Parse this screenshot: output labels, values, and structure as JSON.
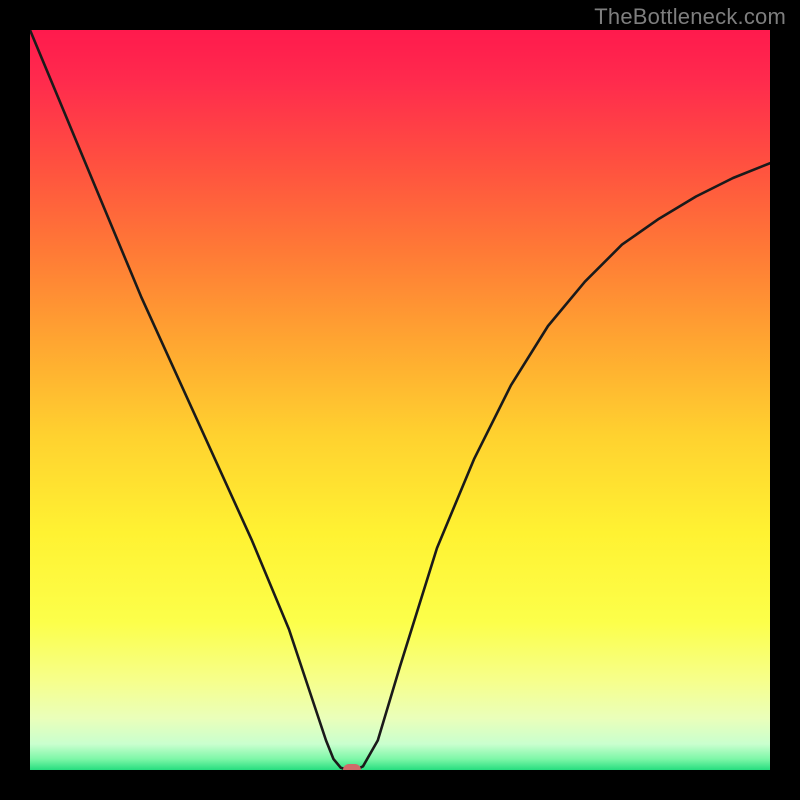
{
  "watermark": "TheBottleneck.com",
  "colors": {
    "frame": "#000000",
    "curve": "#1a1a1a",
    "marker": "#d06a6a",
    "watermark": "#7e7e7e",
    "gradient_stops": [
      {
        "offset": 0.0,
        "color": "#ff1a4d"
      },
      {
        "offset": 0.07,
        "color": "#ff2b4d"
      },
      {
        "offset": 0.18,
        "color": "#ff5040"
      },
      {
        "offset": 0.3,
        "color": "#ff7a36"
      },
      {
        "offset": 0.42,
        "color": "#ffa531"
      },
      {
        "offset": 0.55,
        "color": "#ffd22f"
      },
      {
        "offset": 0.68,
        "color": "#fff232"
      },
      {
        "offset": 0.8,
        "color": "#fcff4a"
      },
      {
        "offset": 0.88,
        "color": "#f6ff8c"
      },
      {
        "offset": 0.93,
        "color": "#eaffba"
      },
      {
        "offset": 0.965,
        "color": "#c9ffce"
      },
      {
        "offset": 0.985,
        "color": "#7ef7a8"
      },
      {
        "offset": 1.0,
        "color": "#26dd7f"
      }
    ]
  },
  "chart_data": {
    "type": "line",
    "title": "",
    "xlabel": "",
    "ylabel": "",
    "xlim": [
      0,
      100
    ],
    "ylim": [
      0,
      100
    ],
    "grid": false,
    "legend": false,
    "series": [
      {
        "name": "bottleneck-curve",
        "x": [
          0,
          5,
          10,
          15,
          20,
          25,
          30,
          35,
          38,
          40,
          41,
          42,
          43,
          44,
          45,
          47,
          50,
          55,
          60,
          65,
          70,
          75,
          80,
          85,
          90,
          95,
          100
        ],
        "y": [
          100,
          88,
          76,
          64,
          53,
          42,
          31,
          19,
          10,
          4,
          1.5,
          0.3,
          0,
          0,
          0.5,
          4,
          14,
          30,
          42,
          52,
          60,
          66,
          71,
          74.5,
          77.5,
          80,
          82
        ]
      }
    ],
    "marker": {
      "x": 43.5,
      "y": 0
    }
  }
}
